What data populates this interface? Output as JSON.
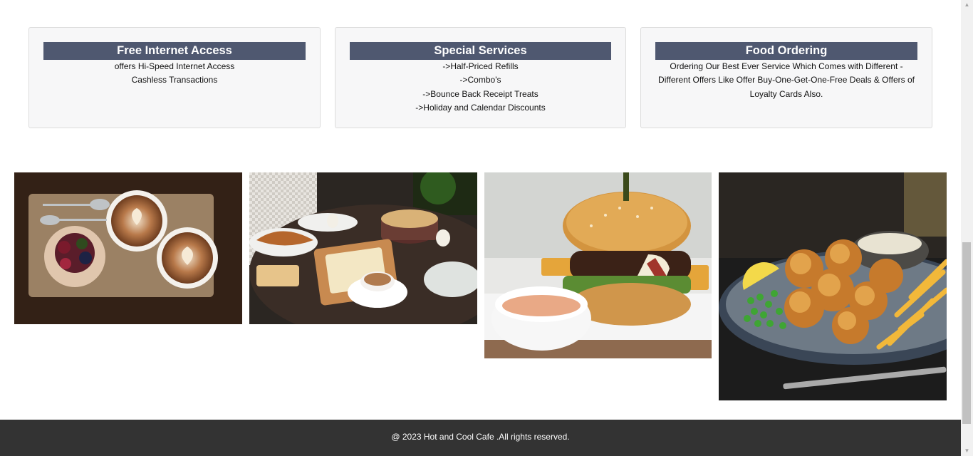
{
  "cards": [
    {
      "title": "Free Internet Access",
      "lines": [
        "offers Hi-Speed Internet Access",
        "Cashless Transactions"
      ]
    },
    {
      "title": "Special Services",
      "lines": [
        "->Half-Priced Refills",
        "->Combo's",
        "->Bounce Back Receipt Treats",
        "->Holiday and Calendar Discounts"
      ]
    },
    {
      "title": "Food Ordering",
      "text": "Ordering Our Best Ever Service Which Comes with Different - Different Offers Like Offer Buy-One-Get-One-Free Deals & Offers of Loyalty Cards Also."
    }
  ],
  "gallery": {
    "images": [
      "latte-art-coffee-and-cake",
      "breakfast-table-spread",
      "burger-with-fries-and-dip",
      "fried-chicken-with-peas-and-fries"
    ]
  },
  "footer": {
    "text": "@ 2023 Hot and Cool Cafe .All rights reserved."
  },
  "colors": {
    "card_title_bg": "#4f5870",
    "footer_bg": "#333333",
    "card_bg": "#f7f7f8"
  }
}
